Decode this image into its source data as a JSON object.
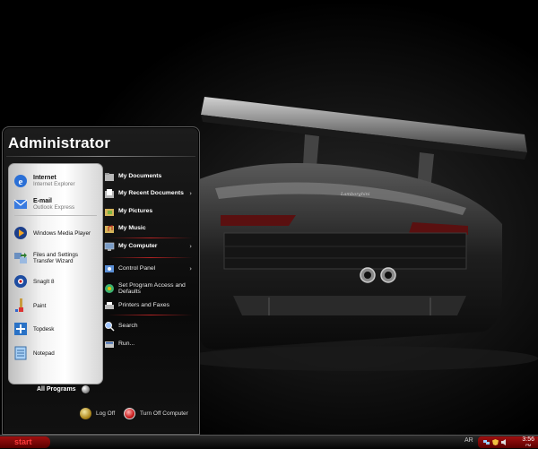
{
  "desktop": {
    "wallpaper": "dark sports car rear view",
    "car_badge": "Lamborghini"
  },
  "start_menu": {
    "user": "Administrator",
    "pinned": [
      {
        "title": "Internet",
        "subtitle": "Internet Explorer",
        "icon": "internet-explorer-icon"
      },
      {
        "title": "E-mail",
        "subtitle": "Outlook Express",
        "icon": "outlook-express-icon"
      }
    ],
    "recent": [
      {
        "label": "Windows Media Player",
        "icon": "media-player-icon"
      },
      {
        "label": "Files and Settings Transfer Wizard",
        "icon": "transfer-wizard-icon"
      },
      {
        "label": "SnagIt 8",
        "icon": "snagit-icon"
      },
      {
        "label": "Paint",
        "icon": "paint-icon"
      },
      {
        "label": "Topdesk",
        "icon": "topdesk-icon"
      },
      {
        "label": "Notepad",
        "icon": "notepad-icon"
      }
    ],
    "all_programs": "All Programs",
    "places": [
      {
        "label": "My Documents",
        "bold": true,
        "arrow": ""
      },
      {
        "label": "My Recent Documents",
        "bold": true,
        "arrow": "›"
      },
      {
        "label": "My Pictures",
        "bold": true,
        "arrow": ""
      },
      {
        "label": "My Music",
        "bold": true,
        "arrow": ""
      },
      {
        "label": "My Computer",
        "bold": true,
        "arrow": "›"
      },
      {
        "label": "Control Panel",
        "bold": false,
        "arrow": "›"
      },
      {
        "label": "Set Program Access and Defaults",
        "bold": false,
        "arrow": ""
      },
      {
        "label": "Printers and Faxes",
        "bold": false,
        "arrow": ""
      },
      {
        "label": "Search",
        "bold": false,
        "arrow": ""
      },
      {
        "label": "Run...",
        "bold": false,
        "arrow": ""
      }
    ],
    "log_off": "Log Off",
    "turn_off": "Turn Off Computer"
  },
  "taskbar": {
    "start_label": "start",
    "language": "AR",
    "clock_time": "3:56",
    "clock_period": "PM"
  },
  "colors": {
    "accent": "#a01010",
    "start_text": "#ff3c3c"
  }
}
